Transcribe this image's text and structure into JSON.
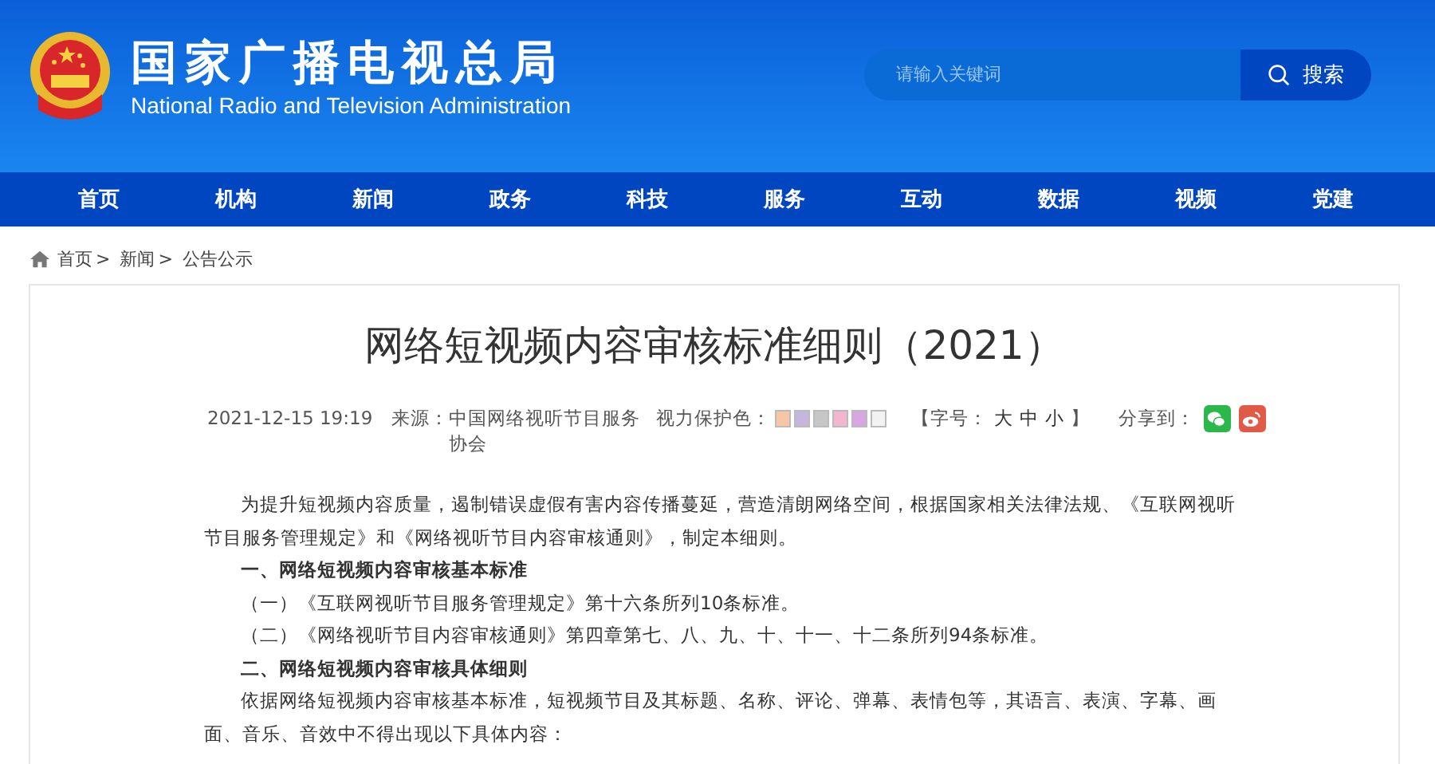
{
  "header": {
    "title": "国家广播电视总局",
    "subtitle": "National Radio and Television Administration"
  },
  "search": {
    "placeholder": "请输入关键词",
    "button": "搜索"
  },
  "nav": [
    {
      "label": "首页"
    },
    {
      "label": "机构"
    },
    {
      "label": "新闻"
    },
    {
      "label": "政务"
    },
    {
      "label": "科技"
    },
    {
      "label": "服务"
    },
    {
      "label": "互动"
    },
    {
      "label": "数据"
    },
    {
      "label": "视频"
    },
    {
      "label": "党建"
    }
  ],
  "breadcrumb": {
    "separator": ">",
    "items": [
      "首页",
      "新闻",
      "公告公示"
    ]
  },
  "article": {
    "title": "网络短视频内容审核标准细则（2021）",
    "date": "2021-12-15 19:19",
    "source_label": "来源：",
    "source": "中国网络视听节目服务协会",
    "eye_label": "视力保护色：",
    "eye_colors": [
      {
        "color": "#f6c6a6"
      },
      {
        "color": "#c4b6de"
      },
      {
        "color": "#c6c6c6"
      },
      {
        "color": "#f2b6ce"
      },
      {
        "color": "#d8a6e0"
      },
      {
        "color": "#f2f2f2"
      }
    ],
    "font_size_open": "【字号：",
    "font_sizes": [
      "大",
      "中",
      "小"
    ],
    "font_size_close": "】",
    "share_label": "分享到：",
    "paragraphs": [
      {
        "kind": "body",
        "text": "为提升短视频内容质量，遏制错误虚假有害内容传播蔓延，营造清朗网络空间，根据国家相关法律法规、《互联网视听节目服务管理规定》和《网络视听节目内容审核通则》，制定本细则。"
      },
      {
        "kind": "heading",
        "text": "一、网络短视频内容审核基本标准"
      },
      {
        "kind": "body",
        "text": "（一）《互联网视听节目服务管理规定》第十六条所列10条标准。"
      },
      {
        "kind": "body",
        "text": "（二）《网络视听节目内容审核通则》第四章第七、八、九、十、十一、十二条所列94条标准。"
      },
      {
        "kind": "heading",
        "text": "二、网络短视频内容审核具体细则"
      },
      {
        "kind": "body",
        "text": "依据网络短视频内容审核基本标准，短视频节目及其标题、名称、评论、弹幕、表情包等，其语言、表演、字幕、画面、音乐、音效中不得出现以下具体内容："
      }
    ]
  }
}
